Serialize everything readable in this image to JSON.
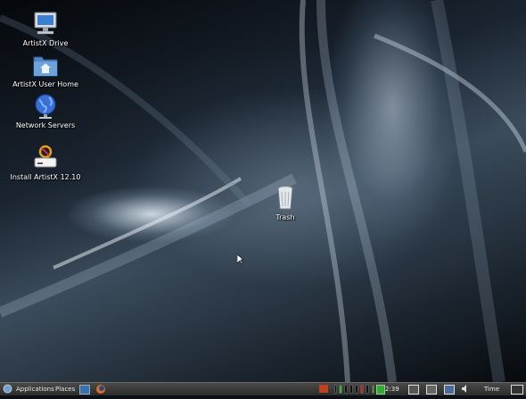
{
  "desktop": {
    "icons": [
      {
        "label": "ArtistX Drive",
        "icon": "computer-icon"
      },
      {
        "label": "ArtistX User Home",
        "icon": "home-folder-icon"
      },
      {
        "label": "Network Servers",
        "icon": "network-globe-icon"
      },
      {
        "label": "Install ArtistX 12.10",
        "icon": "installer-icon"
      },
      {
        "label": "Trash",
        "icon": "trash-icon"
      }
    ]
  },
  "panel": {
    "menu_applications": "Applications",
    "menu_places": "Places",
    "clock_small": "2:39",
    "time_label": "Time",
    "colors": {
      "panel_bg": "#3a3a3a",
      "meter_green": "#2ec12e",
      "meter_red": "#d02020"
    }
  }
}
